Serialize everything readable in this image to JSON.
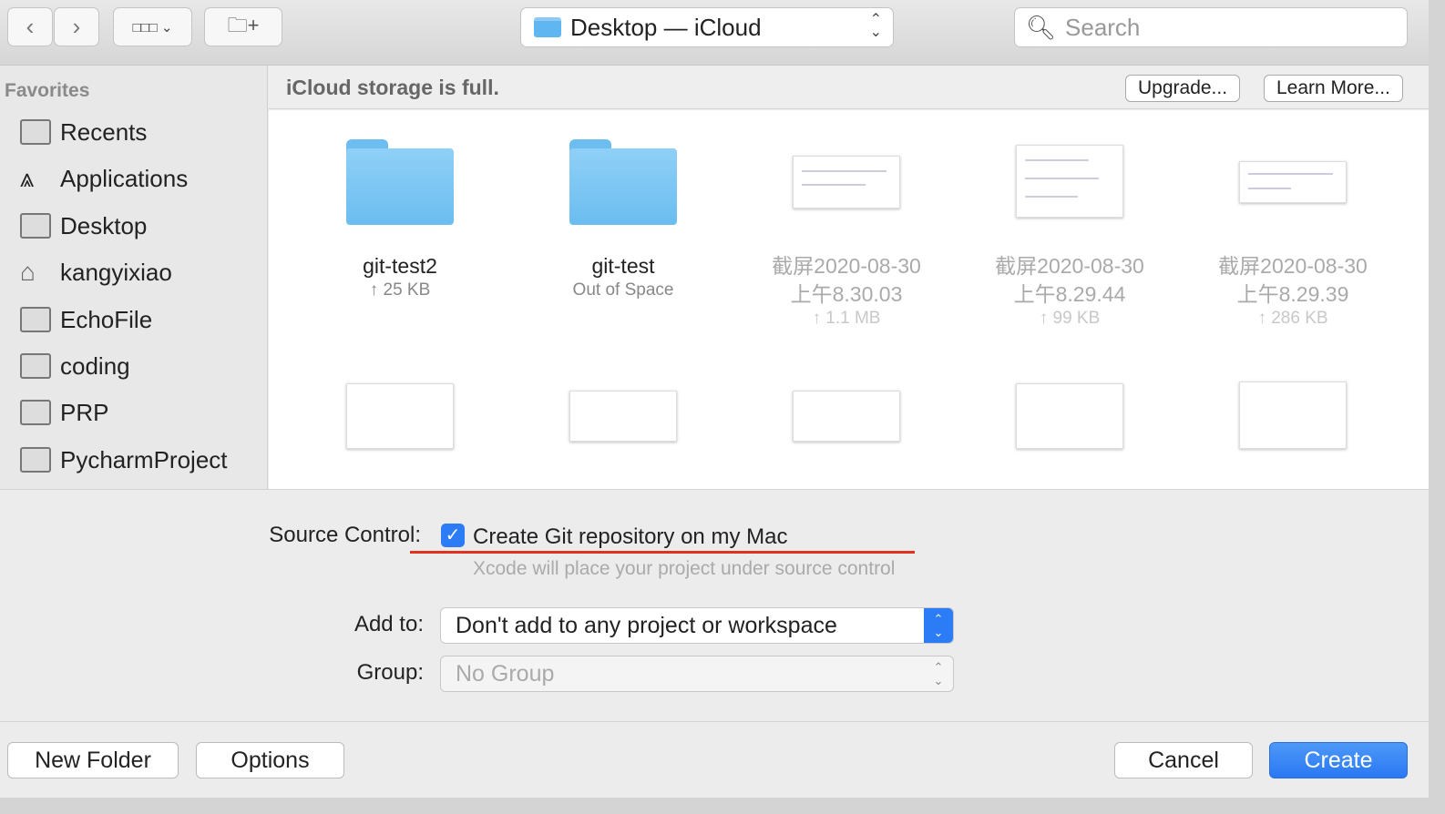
{
  "toolbar": {
    "path": "Desktop — iCloud",
    "search_placeholder": "Search"
  },
  "sidebar": {
    "heading": "Favorites",
    "items": [
      {
        "label": "Recents",
        "icon": "recents-icon"
      },
      {
        "label": "Applications",
        "icon": "applications-icon"
      },
      {
        "label": "Desktop",
        "icon": "desktop-icon"
      },
      {
        "label": "kangyixiao",
        "icon": "home-icon"
      },
      {
        "label": "EchoFile",
        "icon": "folder-icon"
      },
      {
        "label": "coding",
        "icon": "folder-icon"
      },
      {
        "label": "PRP",
        "icon": "folder-icon"
      },
      {
        "label": "PycharmProject",
        "icon": "folder-icon"
      }
    ]
  },
  "banner": {
    "message": "iCloud storage is full.",
    "upgrade": "Upgrade...",
    "learn_more": "Learn More..."
  },
  "files": [
    {
      "name": "git-test2",
      "line2": "",
      "status": "↑ 25 KB",
      "type": "folder"
    },
    {
      "name": "git-test",
      "line2": "",
      "status": "Out of Space",
      "type": "folder"
    },
    {
      "name": "截屏2020-08-30",
      "line2": "上午8.30.03",
      "status": "↑ 1.1 MB",
      "type": "image"
    },
    {
      "name": "截屏2020-08-30",
      "line2": "上午8.29.44",
      "status": "↑ 99 KB",
      "type": "image"
    },
    {
      "name": "截屏2020-08-30",
      "line2": "上午8.29.39",
      "status": "↑ 286 KB",
      "type": "image"
    }
  ],
  "options": {
    "source_control_label": "Source Control:",
    "git_checkbox": "Create Git repository on my Mac",
    "git_checked": true,
    "git_hint": "Xcode will place your project under source control",
    "add_to_label": "Add to:",
    "add_to_value": "Don't add to any project or workspace",
    "group_label": "Group:",
    "group_value": "No Group",
    "annotation_color": "#e0321e"
  },
  "footer": {
    "new_folder": "New Folder",
    "options": "Options",
    "cancel": "Cancel",
    "create": "Create",
    "accent": "#2c7cf6"
  }
}
